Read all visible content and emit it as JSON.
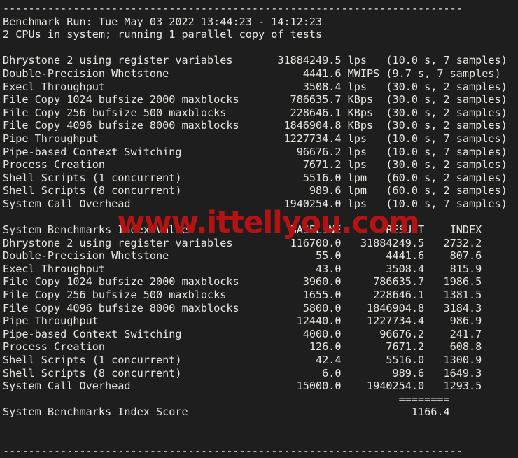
{
  "terminal": {
    "background_color": "#1e1e1e",
    "text_color": "#e8e6e0",
    "top_divider": "------------------------------------------------------------------------",
    "bottom_divider": "------------------------------------------------------------------------",
    "header": {
      "run_line": "Benchmark Run: Tue May 03 2022 13:44:23 - 14:12:23",
      "cpu_line": "2 CPUs in system; running 1 parallel copy of tests"
    },
    "raw_results": [
      "Dhrystone 2 using register variables       31884249.5 lps   (10.0 s, 7 samples)",
      "Double-Precision Whetstone                     4441.6 MWIPS (9.7 s, 7 samples)",
      "Execl Throughput                               3508.4 lps   (30.0 s, 2 samples)",
      "File Copy 1024 bufsize 2000 maxblocks        786635.7 KBps  (30.0 s, 2 samples)",
      "File Copy 256 bufsize 500 maxblocks          228646.1 KBps  (30.0 s, 2 samples)",
      "File Copy 4096 bufsize 8000 maxblocks       1846904.8 KBps  (30.0 s, 2 samples)",
      "Pipe Throughput                             1227734.4 lps   (10.0 s, 7 samples)",
      "Pipe-based Context Switching                  96676.2 lps   (10.0 s, 7 samples)",
      "Process Creation                               7671.2 lps   (30.0 s, 2 samples)",
      "Shell Scripts (1 concurrent)                   5516.0 lpm   (60.0 s, 2 samples)",
      "Shell Scripts (8 concurrent)                    989.6 lpm   (60.0 s, 2 samples)",
      "System Call Overhead                        1940254.0 lps   (10.0 s, 7 samples)"
    ],
    "index_table": {
      "header_line": "System Benchmarks Index Values               BASELINE       RESULT    INDEX",
      "rows": [
        "Dhrystone 2 using register variables         116700.0   31884249.5   2732.2",
        "Double-Precision Whetstone                       55.0       4441.6    807.6",
        "Execl Throughput                                 43.0       3508.4    815.9",
        "File Copy 1024 bufsize 2000 maxblocks          3960.0     786635.7   1986.5",
        "File Copy 256 bufsize 500 maxblocks            1655.0     228646.1   1381.5",
        "File Copy 4096 bufsize 8000 maxblocks          5800.0    1846904.8   3184.3",
        "Pipe Throughput                               12440.0    1227734.4    986.9",
        "Pipe-based Context Switching                   4000.0      96676.2    241.7",
        "Process Creation                                126.0       7671.2    608.8",
        "Shell Scripts (1 concurrent)                     42.4       5516.0   1300.9",
        "Shell Scripts (8 concurrent)                      6.0        989.6   1649.3",
        "System Call Overhead                          15000.0    1940254.0   1293.5"
      ],
      "separator_line": "                                                              ========",
      "score_line": "System Benchmarks Index Score                                   1166.4"
    }
  },
  "watermark": {
    "text": "www.ittellyou.com",
    "color": "#b51313"
  }
}
